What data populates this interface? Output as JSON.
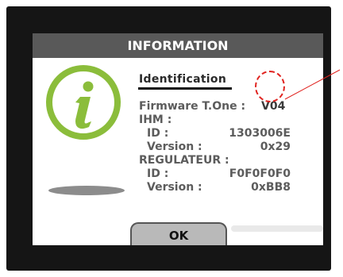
{
  "dialog": {
    "title": "INFORMATION",
    "ok_label": "OK"
  },
  "identification": {
    "heading": "Identification",
    "firmware_label": "Firmware T.One :",
    "firmware_value": "V04",
    "ihm_label": "IHM :",
    "ihm_id_label": "ID :",
    "ihm_id_value": "1303006E",
    "ihm_version_label": "Version :",
    "ihm_version_value": "0x29",
    "regulateur_label": "REGULATEUR :",
    "regulateur_id_label": "ID :",
    "regulateur_id_value": "F0F0F0F0",
    "regulateur_version_label": "Version :",
    "regulateur_version_value": "0xBB8"
  },
  "icons": {
    "info": "info-icon",
    "highlight": "dashed-circle-annotation"
  },
  "colors": {
    "bezel": "#151515",
    "title_bar": "#595959",
    "info_green": "#8bbd3b",
    "annotation_red": "#e0231f",
    "button_gray": "#b9b9b9"
  }
}
